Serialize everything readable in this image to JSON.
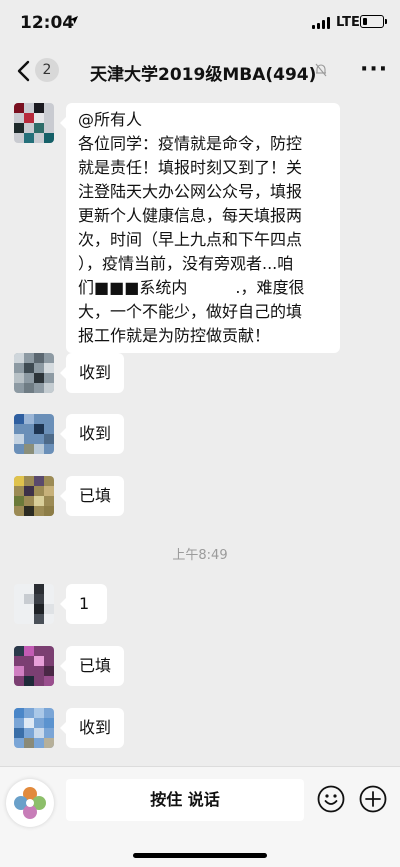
{
  "status": {
    "time": "12:04",
    "network": "LTE",
    "battery_level": 0.2
  },
  "nav": {
    "unread_count": "2",
    "title": "天津大学2019级MBA(494)"
  },
  "messages": [
    {
      "type": "text",
      "lines": [
        "@所有人",
        "各位同学：疫情就是命令，防控",
        "就是责任！填报时刻又到了！关",
        "注登陆天大办公网公众号，填报",
        "更新个人健康信息，每天填报两",
        "次，时间（早上九点和下午四点",
        "），疫情当前，没有旁观者...咱",
        "们■■■系统内　　　.，难度很",
        "大，一个不能少，做好自己的填",
        "报工作就是为防控做贡献！"
      ]
    },
    {
      "type": "text",
      "text": "收到"
    },
    {
      "type": "text",
      "text": "收到"
    },
    {
      "type": "text",
      "text": "已填"
    },
    {
      "type": "time",
      "text": "上午8:49"
    },
    {
      "type": "text",
      "text": "1"
    },
    {
      "type": "text",
      "text": "已填"
    },
    {
      "type": "text",
      "text": "收到"
    }
  ],
  "input": {
    "press_to_talk": "按住 说话"
  },
  "icons": [
    "back-chevron-icon",
    "mute-bell-icon",
    "more-icon",
    "voice-icon",
    "emoji-icon",
    "plus-icon"
  ]
}
